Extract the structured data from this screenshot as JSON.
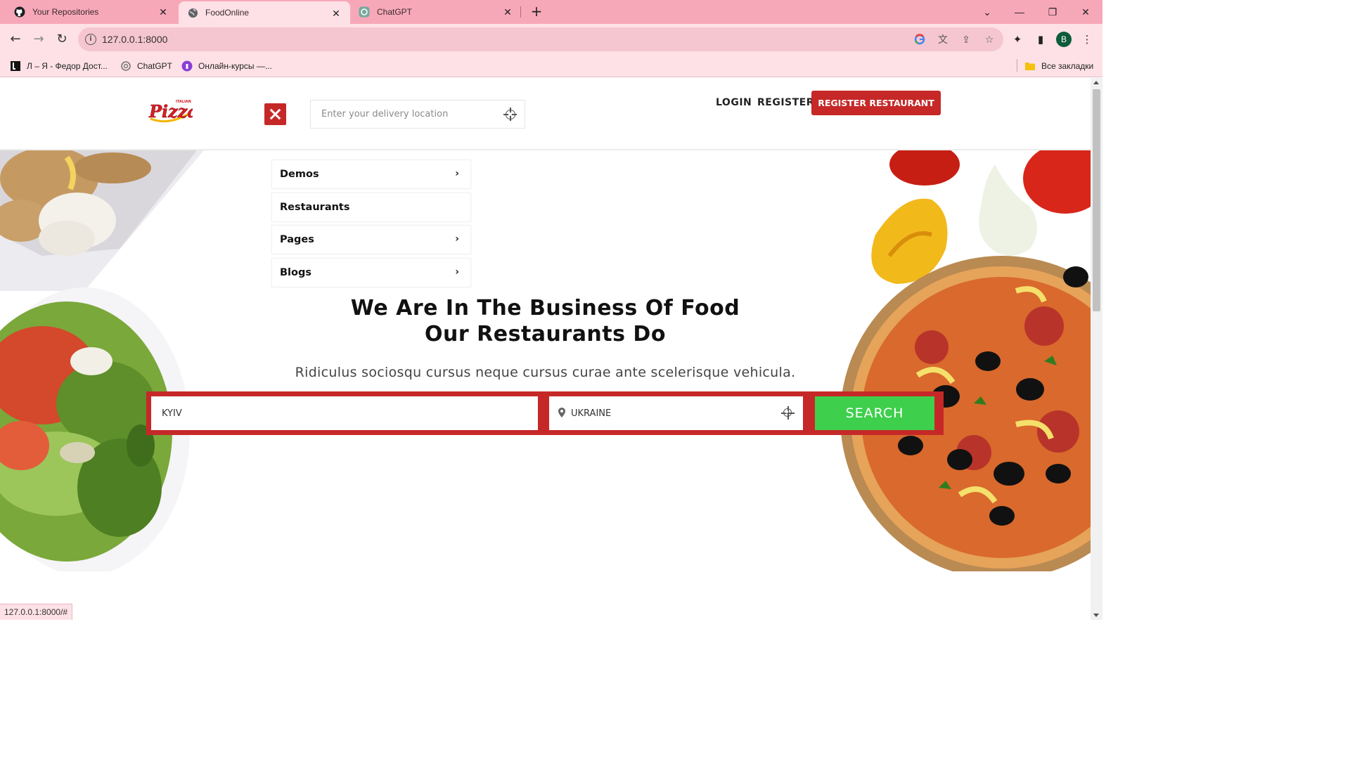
{
  "browser": {
    "tabs": [
      {
        "title": "Your Repositories",
        "icon": "github-icon"
      },
      {
        "title": "FoodOnline",
        "icon": "globe-icon"
      },
      {
        "title": "ChatGPT",
        "icon": "chatgpt-icon"
      }
    ],
    "url": "127.0.0.1:8000",
    "bookmarks": [
      {
        "label": "Л – Я - Федор Дост..."
      },
      {
        "label": "ChatGPT"
      },
      {
        "label": "Онлайн-курсы —..."
      }
    ],
    "all_bookmarks": "Все закладки",
    "profile_initial": "B",
    "status_url": "127.0.0.1:8000/#"
  },
  "site": {
    "logo_text": "Pizza",
    "logo_small": "ITALIAN",
    "location_placeholder": "Enter your delivery location",
    "nav": {
      "login": "LOGIN",
      "register": "REGISTER",
      "register_restaurant": "REGISTER RESTAURANT"
    },
    "menu": [
      {
        "label": "Demos",
        "has_submenu": true
      },
      {
        "label": "Restaurants",
        "has_submenu": false
      },
      {
        "label": "Pages",
        "has_submenu": true
      },
      {
        "label": "Blogs",
        "has_submenu": true
      }
    ],
    "hero": {
      "title_line1": "We Are In The Business Of Food",
      "title_line2": "Our Restaurants Do",
      "subtitle": "Ridiculus sociosqu cursus neque cursus curae ante scelerisque vehicula.",
      "city_value": "KYIV",
      "country_value": "UKRAINE",
      "search_label": "SEARCH"
    }
  },
  "colors": {
    "tabbar": "#f7a8b8",
    "chrome": "#fde1e7",
    "brand_red": "#c62828",
    "search_green": "#3ecf4c"
  }
}
